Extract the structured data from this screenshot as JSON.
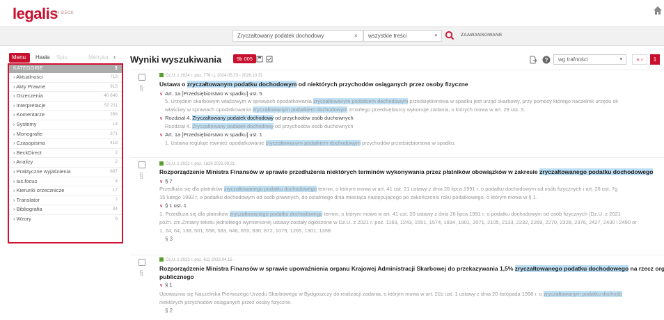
{
  "brand": {
    "logo": "legalis",
    "sub": "C.H.BECK"
  },
  "search": {
    "query": "Zryczałtowany podatek dochodowy",
    "clear": "×",
    "scope": "wszystkie treści",
    "scope_arrow": "▾",
    "advanced": "ZAAWANSOWANE"
  },
  "left": {
    "tabs": [
      "Menu",
      "Hasła",
      "Spis treści",
      "Metryka"
    ],
    "collapse": "‹",
    "header": {
      "label": "KATEGORIE",
      "count": "3"
    },
    "categories": [
      {
        "label": "Aktualności",
        "count": "713"
      },
      {
        "label": "Akty Prawne",
        "count": "915"
      },
      {
        "label": "Orzeczenia",
        "count": "40 646"
      },
      {
        "label": "Interpretacje",
        "count": "52 211"
      },
      {
        "label": "Komentarze",
        "count": "356"
      },
      {
        "label": "Systemy",
        "count": "14"
      },
      {
        "label": "Monografie",
        "count": "271"
      },
      {
        "label": "Czasopisma",
        "count": "418"
      },
      {
        "label": "BeckDirect",
        "count": "2"
      },
      {
        "label": "Analizy",
        "count": "2"
      },
      {
        "label": "Praktyczne wyjaśnienia",
        "count": "887"
      },
      {
        "label": "ius.focus",
        "count": "4"
      },
      {
        "label": "Kierunki orzecznicze",
        "count": "17"
      },
      {
        "label": "Translator",
        "count": "7"
      },
      {
        "label": "Bibliografia",
        "count": "34"
      },
      {
        "label": "Wzory",
        "count": "6"
      }
    ]
  },
  "results": {
    "title": "Wyniki wyszukiwania",
    "count": "9b 005",
    "sort": "wg trafności",
    "sort_arrow": "▾",
    "pager_prev": "« ‹",
    "page": "1",
    "items": [
      {
        "meta": "Dz.U. z 2024 r. poz. 776 t.j.   2024.05.23 - 2026.10.31",
        "title_pre": "Ustawa o ",
        "title_hl": "zryczałtowanym podatku dochodowym",
        "title_post": " od niektórych przychodów osiąganych przez osoby fizyczne",
        "l1": "Art. 1a [Przedsiębiorstwo w spadku] ust. 5",
        "l2_pre": "5. Urzędem skarbowym właściwym w sprawach opodatkowania ",
        "l2_hl": "zryczałtowanym podatkiem dochodowym",
        "l2_post": " przedsiębiorstwa w spadku jest urząd skarbowy, przy pomocy którego naczelnik urzędu sk",
        "l3_pre": "właściwy w sprawach opodatkowania ",
        "l3_hl": "zryczałtowanym podatkiem dochodowym",
        "l3_post": " zmarłego przedsiębiorcy wykonuje zadania, o których mowa w art. 29 ust. 5.",
        "l4_pre": "Rozdział 4. ",
        "l4_hl": "Zryczałtowany podatek dochodowy",
        "l4_post": " od przychodów osób duchownych",
        "l5_pre": "Rozdział 4. ",
        "l5_hl": "Zryczałtowany podatek dochodowy",
        "l5_post": " od przychodów osób duchownych",
        "l6": "Art. 1a [Przedsiębiorstwo w spadku] ust. 1",
        "l7_pre": "1. Ustawa reguluje również opodatkowanie ",
        "l7_hl": "zryczałtowanym podatkiem dochodowym",
        "l7_post": " przychodów przedsiębiorstwa w spadku."
      },
      {
        "meta": "Dz.U. z 2022 r. poz. 1829   2022.08.31 -",
        "title_pre": "Rozporządzenie Ministra Finansów w sprawie przedłużenia niektórych terminów wykonywania przez płatników obowiązków w zakresie ",
        "title_hl": "zryczałtowanego podatku dochodowego",
        "l1": "§ 7",
        "l2_pre": "Przedłuża się dla płatników ",
        "l2_hl": "zryczałtowanego podatku dochodowego",
        "l2_post": " termin, o którym mowa w art. 41 ust. 21 ustawy z dnia 26 lipca 1991 r. o podatku dochodowym od osób fizycznych i art. 26 ust. 7g",
        "l3": "15 lutego 1992 r. o podatku dochodowym od osób prawnych, do ostatniego dnia miesiąca następującego po zakończeniu roku podatkowego, o którym mowa w § 1.",
        "l4": "§ 1 ust. 1",
        "l5_pre": "1. Przedłuża się dla płatników ",
        "l5_hl": "zryczałtowanego podatku dochodowego",
        "l5_post": " termin, o którym mowa w art. 41 ust. 20 ustawy z dnia 26 lipca 1991 r. o podatku dochodowym od osób fizycznych (Dz.U. z 2021",
        "l6": "późn. zm.Zmiany tekstu jednolitego wymienionej ustawy zostały ogłoszone w Dz.U. z 2021 r. poz. 1163, 1243, 1551, 1574, 1834, 1901, 2071, 2105, 2133, 2232, 2269, 2270, 2328, 2376, 2427, 2430 i 2490 or",
        "l7": "1, 24, 64, 138, 501, 558, 583, 646, 655, 830, 872, 1079, 1265, 1301, 1358",
        "l8": "§ 3"
      },
      {
        "meta": "Dz.U. z 2023 r. poz. 611   2023.04.15 -",
        "title_pre": "Rozporządzenie Ministra Finansów w sprawie upoważnienia organu Krajowej Administracji Skarbowej do przekazywania 1,5% ",
        "title_hl": "zryczałtowanego podatku dochodowego",
        "title_post": " na rzecz organizacji po",
        "title_line2": "publicznego",
        "l1": "§ 1",
        "l2_pre": "Upoważnia się Naczelnika Pierwszego Urzędu Skarbowego w Bydgoszczy do realizacji zadania, o którym mowa w art. 21b ust. 1 ustawy z dnia 20 listopada 1998 r. o ",
        "l2_hl": "zryczałtowanym podatku dochodo",
        "l3": "niektórych przychodów osiąganych przez osoby fizyczne.",
        "l4": "§ 2"
      }
    ]
  },
  "colors": {
    "accent": "#c8102e",
    "highlight": "#bfe0f5",
    "panel_border": "#d0102e"
  },
  "icons": [
    "home-icon",
    "search-icon",
    "export-icon",
    "help-icon",
    "save-icon",
    "check-icon",
    "document-icon",
    "section-icon"
  ]
}
